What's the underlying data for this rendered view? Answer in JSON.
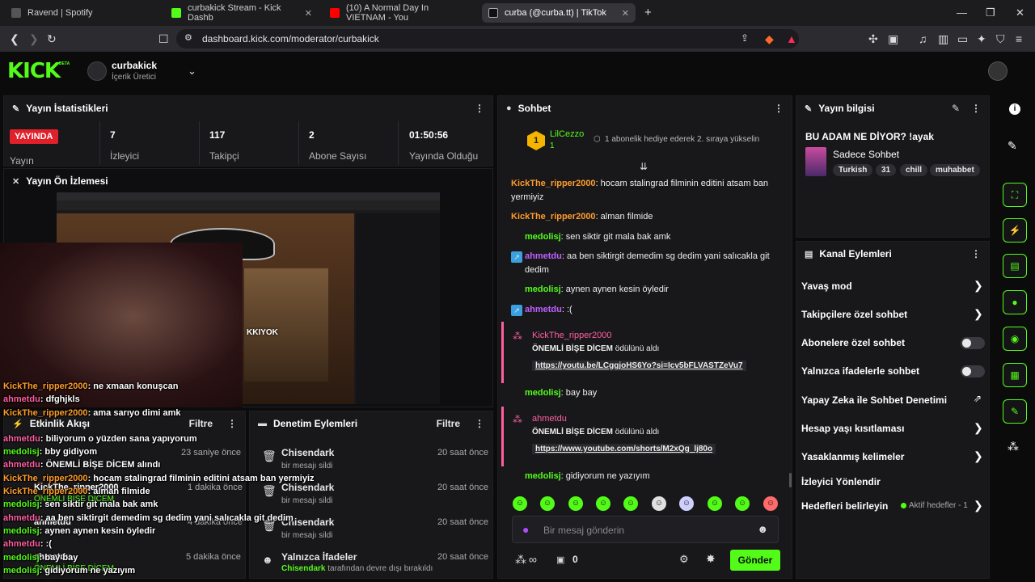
{
  "browser": {
    "tabs": [
      {
        "title": "Ravend | Spotify"
      },
      {
        "title": "curbakick Stream - Kick Dashb"
      },
      {
        "title": "(10) A Normal Day In VIETNAM - You"
      },
      {
        "title": "curba (@curba.tt) | TikTok"
      }
    ],
    "url": "dashboard.kick.com/moderator/curbakick"
  },
  "header": {
    "logo": "KICK",
    "logo_beta": "BETA",
    "channel_name": "curbakick",
    "channel_role": "İçerik Üretici"
  },
  "stats": {
    "title": "Yayın İstatistikleri",
    "live_badge": "YAYINDA",
    "live_label": "Yayın",
    "viewers_value": "7",
    "viewers_label": "İzleyici",
    "followers_value": "117",
    "followers_label": "Takipçi",
    "subs_value": "2",
    "subs_label": "Abone Sayısı",
    "uptime_value": "01:50:56",
    "uptime_label": "Yayında Olduğu"
  },
  "preview": {
    "title": "Yayın Ön İzlemesi",
    "cam_text": "KKIYOK"
  },
  "overlay_chat": [
    {
      "user": "KickThe_ripper2000",
      "text": ": ne xmaan konuşcan"
    },
    {
      "user": "ahmetdu",
      "text": ": dfghjkls"
    },
    {
      "user": "KickThe_ripper2000",
      "text": ": ama sarıyo dimi amk"
    },
    {
      "user": "ahmetdu",
      "text": ": biliyorum o yüzden sana yapıyorum"
    },
    {
      "user": "medolisj",
      "text": ": bby gidiyom"
    },
    {
      "user": "ahmetdu",
      "text": ": ÖNEMLİ BİŞE DİCEM alındı"
    },
    {
      "user": "KickThe_ripper2000",
      "text": ": hocam stalingrad filminin editini atsam ban yermiyiz"
    },
    {
      "user": "KickThe_ripper2000",
      "text": ": alman filmide"
    },
    {
      "user": "medolisj",
      "text": ": sen siktir git mala bak amk"
    },
    {
      "user": "ahmetdu",
      "text": ": aa ben siktirgit demedim sg dedim yani salıcakla git dedim"
    },
    {
      "user": "medolisj",
      "text": ": aynen aynen kesin öyledir"
    },
    {
      "user": "ahmetdu",
      "text": ": :("
    },
    {
      "user": "medolisj",
      "text": ": bay bay"
    },
    {
      "user": "medolisj",
      "text": ": gidiyorum ne yazıyım"
    }
  ],
  "activity": {
    "title": "Etkinlik Akışı",
    "filter": "Filtre",
    "rows": [
      {
        "user": "",
        "time": "23 saniye önce"
      },
      {
        "user": "KickThe_ripper2000",
        "sub": "ÖNEMLİ BİŞE DİCEM",
        "time": "1 dakika önce"
      },
      {
        "user": "ahmetdu",
        "time": "4 dakika önce"
      },
      {
        "user": "ahmetdu",
        "sub": "ÖNEMLİ BİŞE DİCEM",
        "time": "5 dakika önce"
      }
    ]
  },
  "moderation": {
    "title": "Denetim Eylemleri",
    "filter": "Filtre",
    "rows": [
      {
        "user": "Chisendark",
        "action": "bir mesajı sildi",
        "time": "20 saat önce"
      },
      {
        "user": "Chisendark",
        "action": "bir mesajı sildi",
        "time": "20 saat önce"
      },
      {
        "user": "Chisendark",
        "action": "bir mesajı sildi",
        "time": "20 saat önce"
      },
      {
        "user": "Yalnızca İfadeler",
        "action_user": "Chisendark",
        "action": " tarafından devre dışı bırakıldı",
        "time": "20 saat önce"
      }
    ]
  },
  "chat": {
    "title": "Sohbet",
    "pinned_user": "LilCezzo",
    "pinned_count": "1",
    "pinned_text": "1 abonelik hediye ederek 2. sıraya yükselin",
    "messages": [
      {
        "user": "KickThe_ripper2000",
        "text": ": hocam stalingrad filminin editini atsam ban yermiyiz"
      },
      {
        "user": "KickThe_ripper2000",
        "text": ": alman filmide"
      },
      {
        "user": "medolisj",
        "text": ": sen siktir git mala bak amk"
      },
      {
        "user": "ahmetdu",
        "text": ": aa ben siktirgit demedim sg dedim yani salıcakla git dedim"
      },
      {
        "user": "medolisj",
        "text": ": aynen aynen kesin öyledir"
      },
      {
        "user": "ahmetdu",
        "text": ": :("
      },
      {
        "user": "medolisj",
        "text": ": bay bay"
      },
      {
        "user": "medolisj",
        "text": ": gidiyorum ne yazıyım"
      }
    ],
    "redeem1": {
      "user": "KickThe_ripper2000",
      "reward": "ÖNEMLİ BİŞE DİCEM",
      "suffix": " ödülünü aldı",
      "link": "https://youtu.be/LCggjoHS6Yo?si=Icv5bFLVASTZeVu7"
    },
    "redeem2": {
      "user": "ahmetdu",
      "reward": "ÖNEMLİ BİŞE DİCEM",
      "suffix": " ödülünü aldı",
      "link": "https://www.youtube.com/shorts/M2xQg_lj80o"
    },
    "input_placeholder": "Bir mesaj gönderin",
    "points": "0",
    "send": "Gönder"
  },
  "stream_info": {
    "title": "Yayın bilgisi",
    "stream_title": "BU ADAM NE DİYOR? !ayak",
    "category": "Sadece Sohbet",
    "tags": [
      "Turkish",
      "31",
      "chill",
      "muhabbet"
    ]
  },
  "channel_actions": {
    "title": "Kanal Eylemleri",
    "items": [
      {
        "label": "Yavaş mod"
      },
      {
        "label": "Takipçilere özel sohbet"
      },
      {
        "label": "Abonelere özel sohbet"
      },
      {
        "label": "Yalnızca ifadelerle sohbet"
      },
      {
        "label": "Yapay Zeka ile Sohbet Denetimi"
      },
      {
        "label": "Hesap yaşı kısıtlaması"
      },
      {
        "label": "Yasaklanmış kelimeler"
      },
      {
        "label": "İzleyici Yönlendir"
      },
      {
        "label": "Hedefleri belirleyin"
      }
    ],
    "goals_active": "Aktif hedefler - 1"
  },
  "colors": {
    "accent": "#53fc18",
    "panel": "#18181b",
    "live": "#e0202a"
  }
}
